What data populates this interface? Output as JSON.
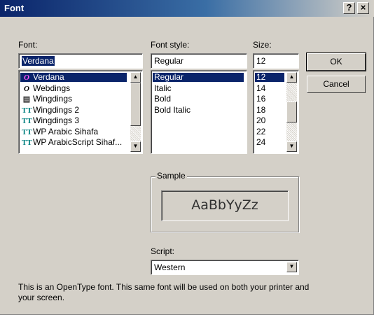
{
  "window": {
    "title": "Font",
    "help_button": "?",
    "close_button": "×"
  },
  "font": {
    "label": "Font:",
    "value": "Verdana",
    "items": [
      {
        "icon": "O",
        "icon_name": "opentype-font-icon",
        "name": "Verdana",
        "selected": true
      },
      {
        "icon": "O",
        "icon_name": "opentype-font-icon",
        "name": "Webdings",
        "selected": false
      },
      {
        "icon": "▤",
        "icon_name": "printer-font-icon",
        "name": "Wingdings",
        "selected": false
      },
      {
        "icon": "TT",
        "icon_name": "truetype-font-icon",
        "name": "Wingdings 2",
        "selected": false
      },
      {
        "icon": "TT",
        "icon_name": "truetype-font-icon",
        "name": "Wingdings 3",
        "selected": false
      },
      {
        "icon": "TT",
        "icon_name": "truetype-font-icon",
        "name": "WP Arabic Sihafa",
        "selected": false
      },
      {
        "icon": "TT",
        "icon_name": "truetype-font-icon",
        "name": "WP ArabicScript Sihaf...",
        "selected": false
      }
    ]
  },
  "style": {
    "label": "Font style:",
    "value": "Regular",
    "items": [
      {
        "name": "Regular",
        "selected": true
      },
      {
        "name": "Italic",
        "selected": false
      },
      {
        "name": "Bold",
        "selected": false
      },
      {
        "name": "Bold Italic",
        "selected": false
      }
    ]
  },
  "size": {
    "label": "Size:",
    "value": "12",
    "items": [
      {
        "name": "12",
        "selected": true
      },
      {
        "name": "14",
        "selected": false
      },
      {
        "name": "16",
        "selected": false
      },
      {
        "name": "18",
        "selected": false
      },
      {
        "name": "20",
        "selected": false
      },
      {
        "name": "22",
        "selected": false
      },
      {
        "name": "24",
        "selected": false
      }
    ]
  },
  "buttons": {
    "ok": "OK",
    "cancel": "Cancel"
  },
  "sample": {
    "label": "Sample",
    "text": "AaBbYyZz"
  },
  "script": {
    "label": "Script:",
    "value": "Western"
  },
  "description": "This is an OpenType font. This same font will be used on both your printer and your screen.",
  "colors": {
    "selection": "#0a246a",
    "face": "#d4d0c8",
    "titlebar_start": "#0a246a"
  }
}
